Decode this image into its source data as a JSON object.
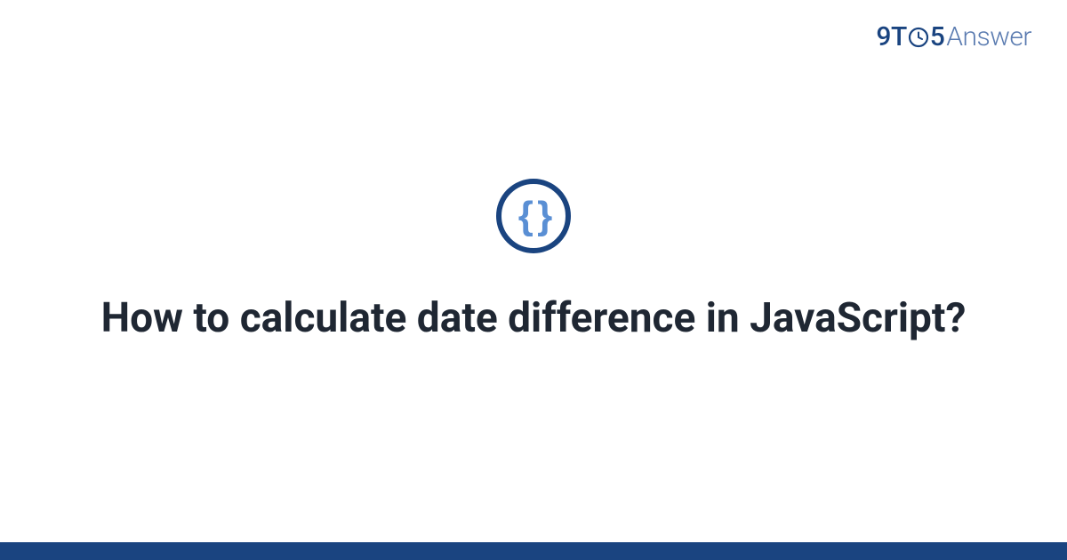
{
  "logo": {
    "nine": "9",
    "t": "T",
    "five": "5",
    "answer": "Answer"
  },
  "badge": {
    "symbol": "{ }"
  },
  "title": "How to calculate date difference in JavaScript?",
  "colors": {
    "brand_dark": "#1a4480",
    "brand_light": "#5a8fd4",
    "text": "#1f2733"
  }
}
